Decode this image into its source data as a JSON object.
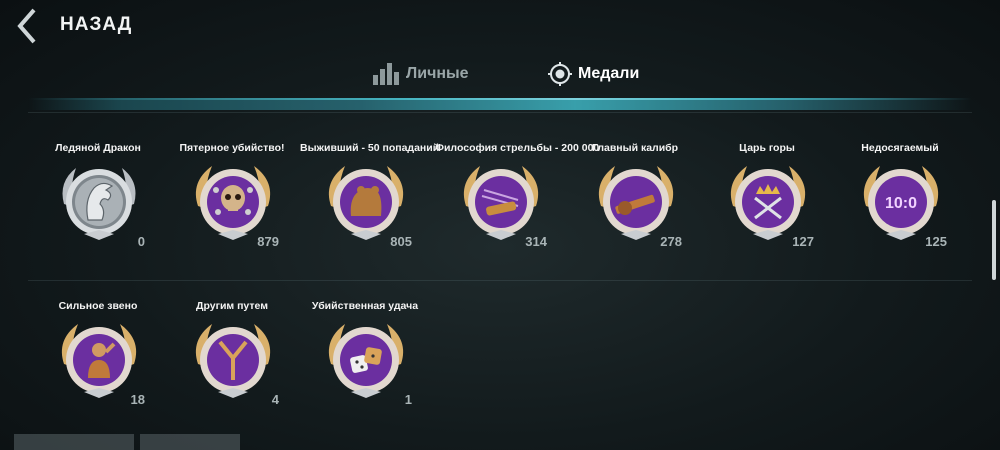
{
  "header": {
    "title": "НАЗАД"
  },
  "tabs": [
    {
      "label": "Личные",
      "icon": "bar-chart-icon",
      "active": false
    },
    {
      "label": "Медали",
      "icon": "medal-target-icon",
      "active": true
    }
  ],
  "medals_row1": [
    {
      "name": "Ледяной Дракон",
      "count": "0",
      "icon": "ice-dragon-icon"
    },
    {
      "name": "Пятерное убийство!",
      "count": "879",
      "icon": "skull-icon"
    },
    {
      "name": "Выживший - 50 попаданий",
      "count": "805",
      "icon": "bear-icon"
    },
    {
      "name": "Философия стрельбы - 200 000",
      "count": "314",
      "icon": "shell-icon"
    },
    {
      "name": "Главный калибр",
      "count": "278",
      "icon": "gun-icon"
    },
    {
      "name": "Царь горы",
      "count": "127",
      "icon": "crown-swords-icon"
    },
    {
      "name": "Недосягаемый",
      "count": "125",
      "icon": "score-10-0-icon"
    }
  ],
  "medals_row2": [
    {
      "name": "Сильное звено",
      "count": "18",
      "icon": "soldier-salute-icon"
    },
    {
      "name": "Другим путем",
      "count": "4",
      "icon": "forked-road-icon"
    },
    {
      "name": "Убийственная удача",
      "count": "1",
      "icon": "dice-icon"
    }
  ],
  "score_badge_text": "10:0",
  "colors": {
    "accent": "#3fb6c4",
    "medal_inner": "#6b2fa0",
    "laurel_gold": "#d9b06a",
    "silver": "#c9cdd1"
  }
}
